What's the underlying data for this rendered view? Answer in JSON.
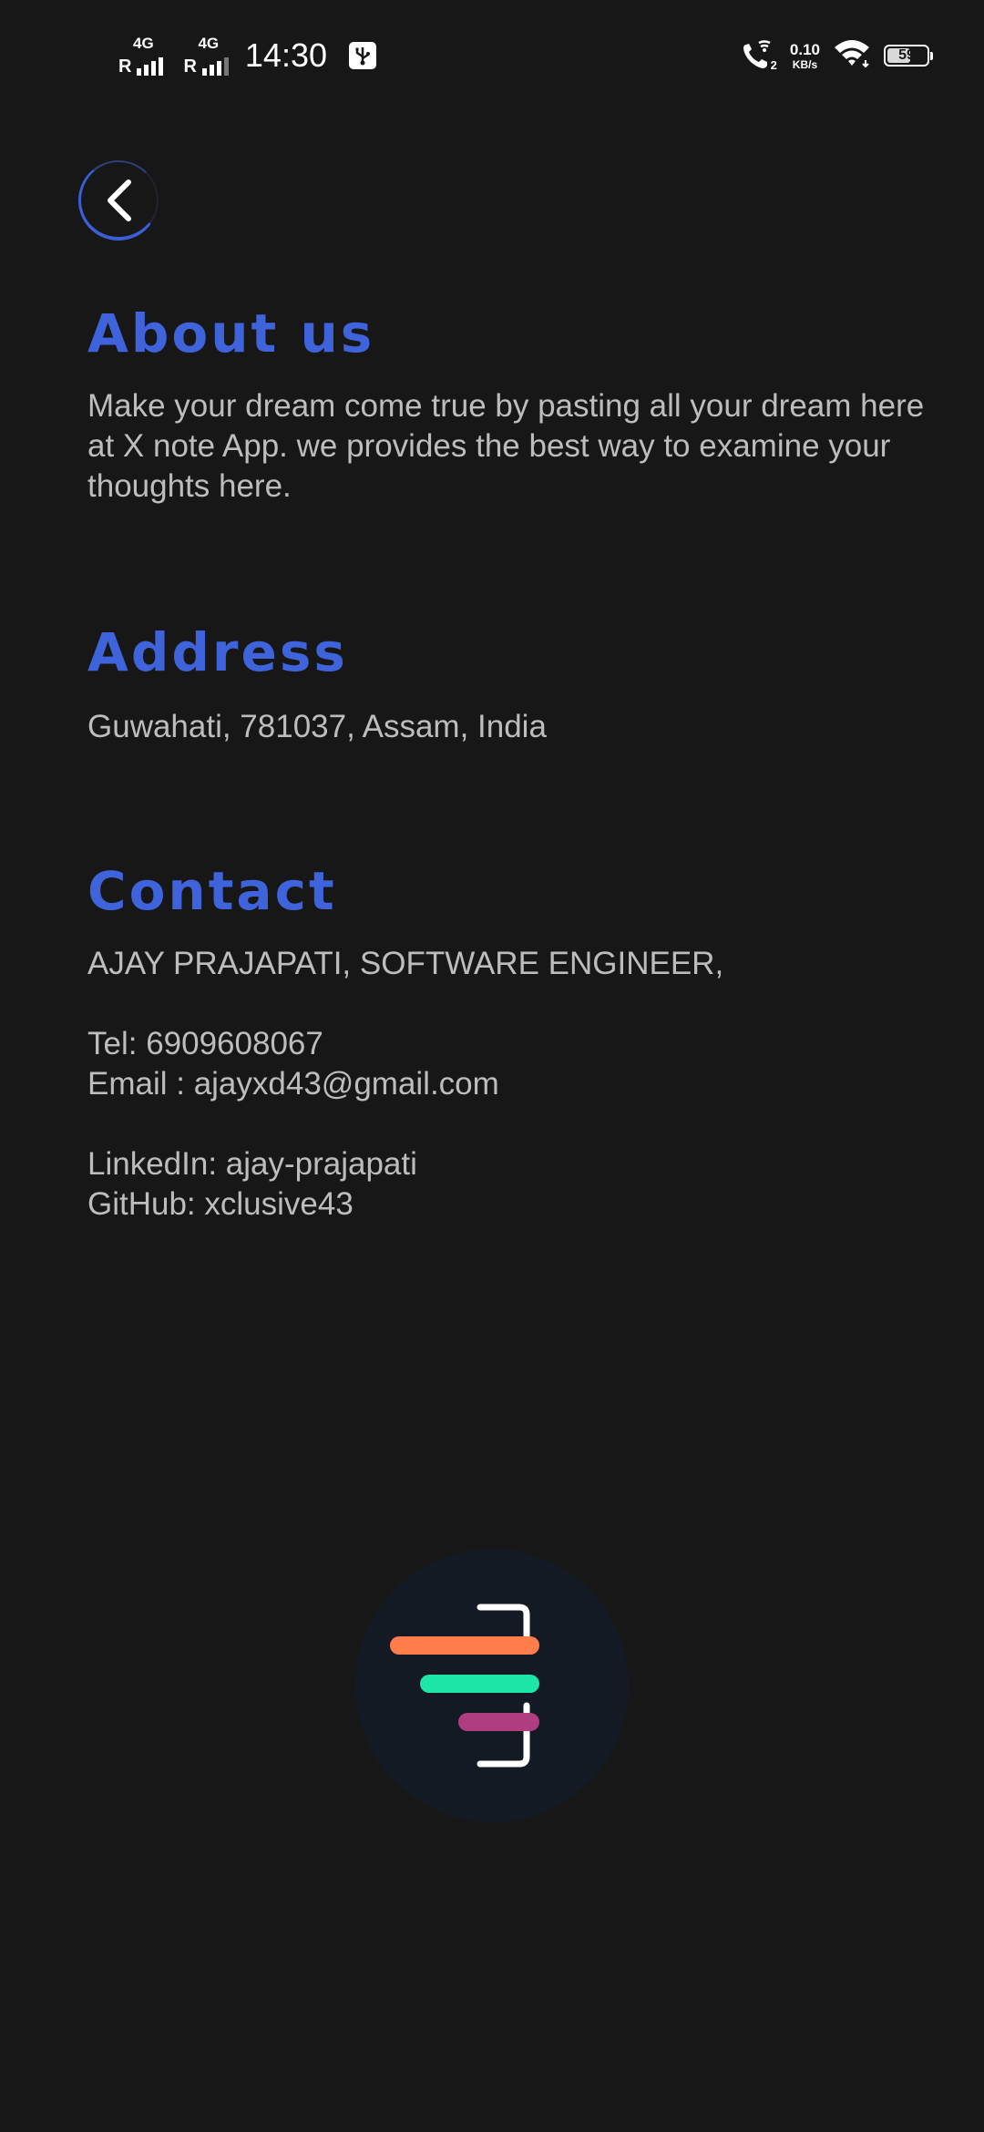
{
  "status_bar": {
    "sim1_roaming": "R",
    "sim1_network": "4G",
    "sim2_roaming": "R",
    "sim2_network": "4G",
    "time": "14:30",
    "vowifi_sim": "2",
    "net_speed_value": "0.10",
    "net_speed_unit": "KB/s",
    "battery_level": "59",
    "battery_fraction": 0.59
  },
  "back": {
    "icon": "chevron-left-icon"
  },
  "about": {
    "title": "About us",
    "text": "Make your dream come true by pasting all your dream here at X note App. we provides the best way to examine your thoughts here."
  },
  "address": {
    "title": "Address",
    "text": "Guwahati, 781037, Assam, India"
  },
  "contact": {
    "title": "Contact",
    "name_line": "AJAY PRAJAPATI, SOFTWARE ENGINEER,",
    "tel": "Tel: 6909608067",
    "email": "Email : ajayxd43@gmail.com",
    "linkedin": "LinkedIn: ajay-prajapati",
    "github": "GitHub: xclusive43"
  },
  "colors": {
    "background": "#171717",
    "accent": "#3f63db",
    "text": "#bdbdbd",
    "logo_bg": "#141a24",
    "logo_orange": "#ff7d4a",
    "logo_green": "#1ee6a8",
    "logo_magenta": "#b03d80"
  }
}
